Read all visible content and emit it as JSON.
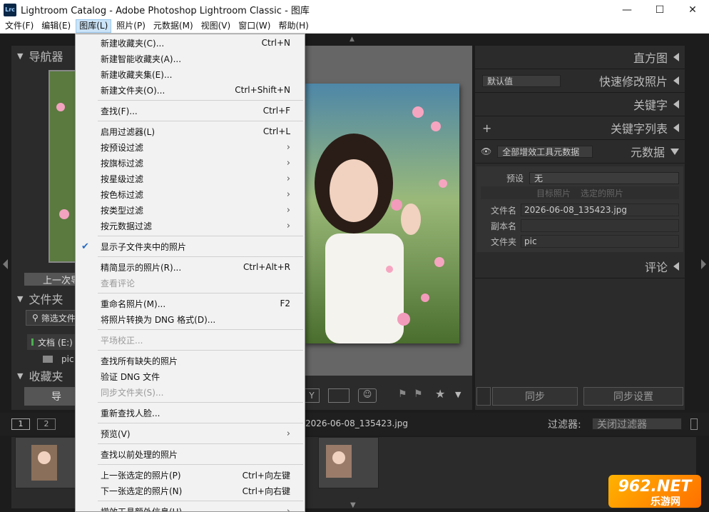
{
  "window": {
    "title": "Lightroom Catalog - Adobe Photoshop Lightroom Classic - 图库",
    "logo": "Lrc"
  },
  "menubar": [
    "文件(F)",
    "编辑(E)",
    "图库(L)",
    "照片(P)",
    "元数据(M)",
    "视图(V)",
    "窗口(W)",
    "帮助(H)"
  ],
  "left_panel": {
    "navigator": "导航器",
    "prev_import": "上一次导",
    "folders": "文件夹",
    "filter_folders": "筛选文件",
    "volume": "文档 (E:)",
    "folder_pic": "pic",
    "collections": "收藏夹",
    "import_btn": "导"
  },
  "right_panel": {
    "histogram": "直方图",
    "quick_develop": "快速修改照片",
    "quick_preset": "默认值",
    "keywording": "关键字",
    "keyword_list": "关键字列表",
    "metadata": "元数据",
    "metadata_set": "全部增效工具元数据",
    "preset_label": "预设",
    "preset_value": "无",
    "target_photo": "目标照片",
    "selected_photos": "选定的照片",
    "fields": [
      {
        "label": "文件名",
        "value": "2026-06-08_135423.jpg"
      },
      {
        "label": "副本名",
        "value": ""
      },
      {
        "label": "文件夹",
        "value": "pic"
      }
    ],
    "comments": "评论",
    "sync_btn": "同步",
    "sync_settings_btn": "同步设置"
  },
  "filmstrip": {
    "page1": "1",
    "page2": "2",
    "filename": "2026-06-08_135423.jpg",
    "filter_label": "过滤器:",
    "filter_value": "关闭过滤器"
  },
  "library_menu": [
    {
      "label": "新建收藏夹(C)...",
      "shortcut": "Ctrl+N"
    },
    {
      "label": "新建智能收藏夹(A)..."
    },
    {
      "label": "新建收藏夹集(E)..."
    },
    {
      "label": "新建文件夹(O)...",
      "shortcut": "Ctrl+Shift+N"
    },
    {
      "sep": true
    },
    {
      "label": "查找(F)...",
      "shortcut": "Ctrl+F"
    },
    {
      "sep": true
    },
    {
      "label": "启用过滤器(L)",
      "shortcut": "Ctrl+L"
    },
    {
      "label": "按预设过滤",
      "submenu": true
    },
    {
      "label": "按旗标过滤",
      "submenu": true
    },
    {
      "label": "按星级过滤",
      "submenu": true
    },
    {
      "label": "按色标过滤",
      "submenu": true
    },
    {
      "label": "按类型过滤",
      "submenu": true
    },
    {
      "label": "按元数据过滤",
      "submenu": true
    },
    {
      "sep": true
    },
    {
      "label": "显示子文件夹中的照片",
      "checked": true
    },
    {
      "sep": true
    },
    {
      "label": "精简显示的照片(R)...",
      "shortcut": "Ctrl+Alt+R"
    },
    {
      "label": "查看评论",
      "disabled": true
    },
    {
      "sep": true
    },
    {
      "label": "重命名照片(M)...",
      "shortcut": "F2"
    },
    {
      "label": "将照片转换为 DNG 格式(D)..."
    },
    {
      "sep": true
    },
    {
      "label": "平场校正...",
      "disabled": true
    },
    {
      "sep": true
    },
    {
      "label": "查找所有缺失的照片"
    },
    {
      "label": "验证 DNG 文件"
    },
    {
      "label": "同步文件夹(S)...",
      "disabled": true
    },
    {
      "sep": true
    },
    {
      "label": "重新查找人脸..."
    },
    {
      "sep": true
    },
    {
      "label": "预览(V)",
      "submenu": true
    },
    {
      "sep": true
    },
    {
      "label": "查找以前处理的照片"
    },
    {
      "sep": true
    },
    {
      "label": "上一张选定的照片(P)",
      "shortcut": "Ctrl+向左键"
    },
    {
      "label": "下一张选定的照片(N)",
      "shortcut": "Ctrl+向右键"
    },
    {
      "sep": true
    },
    {
      "label": "增效工具额外信息(U)",
      "submenu": true
    }
  ],
  "watermark": {
    "brand": "962.NET",
    "sub": "乐游网"
  },
  "colors": {
    "menu_highlight": "#cce4f7",
    "panel_bg": "#2b2b2b",
    "center_bg": "#666666"
  }
}
